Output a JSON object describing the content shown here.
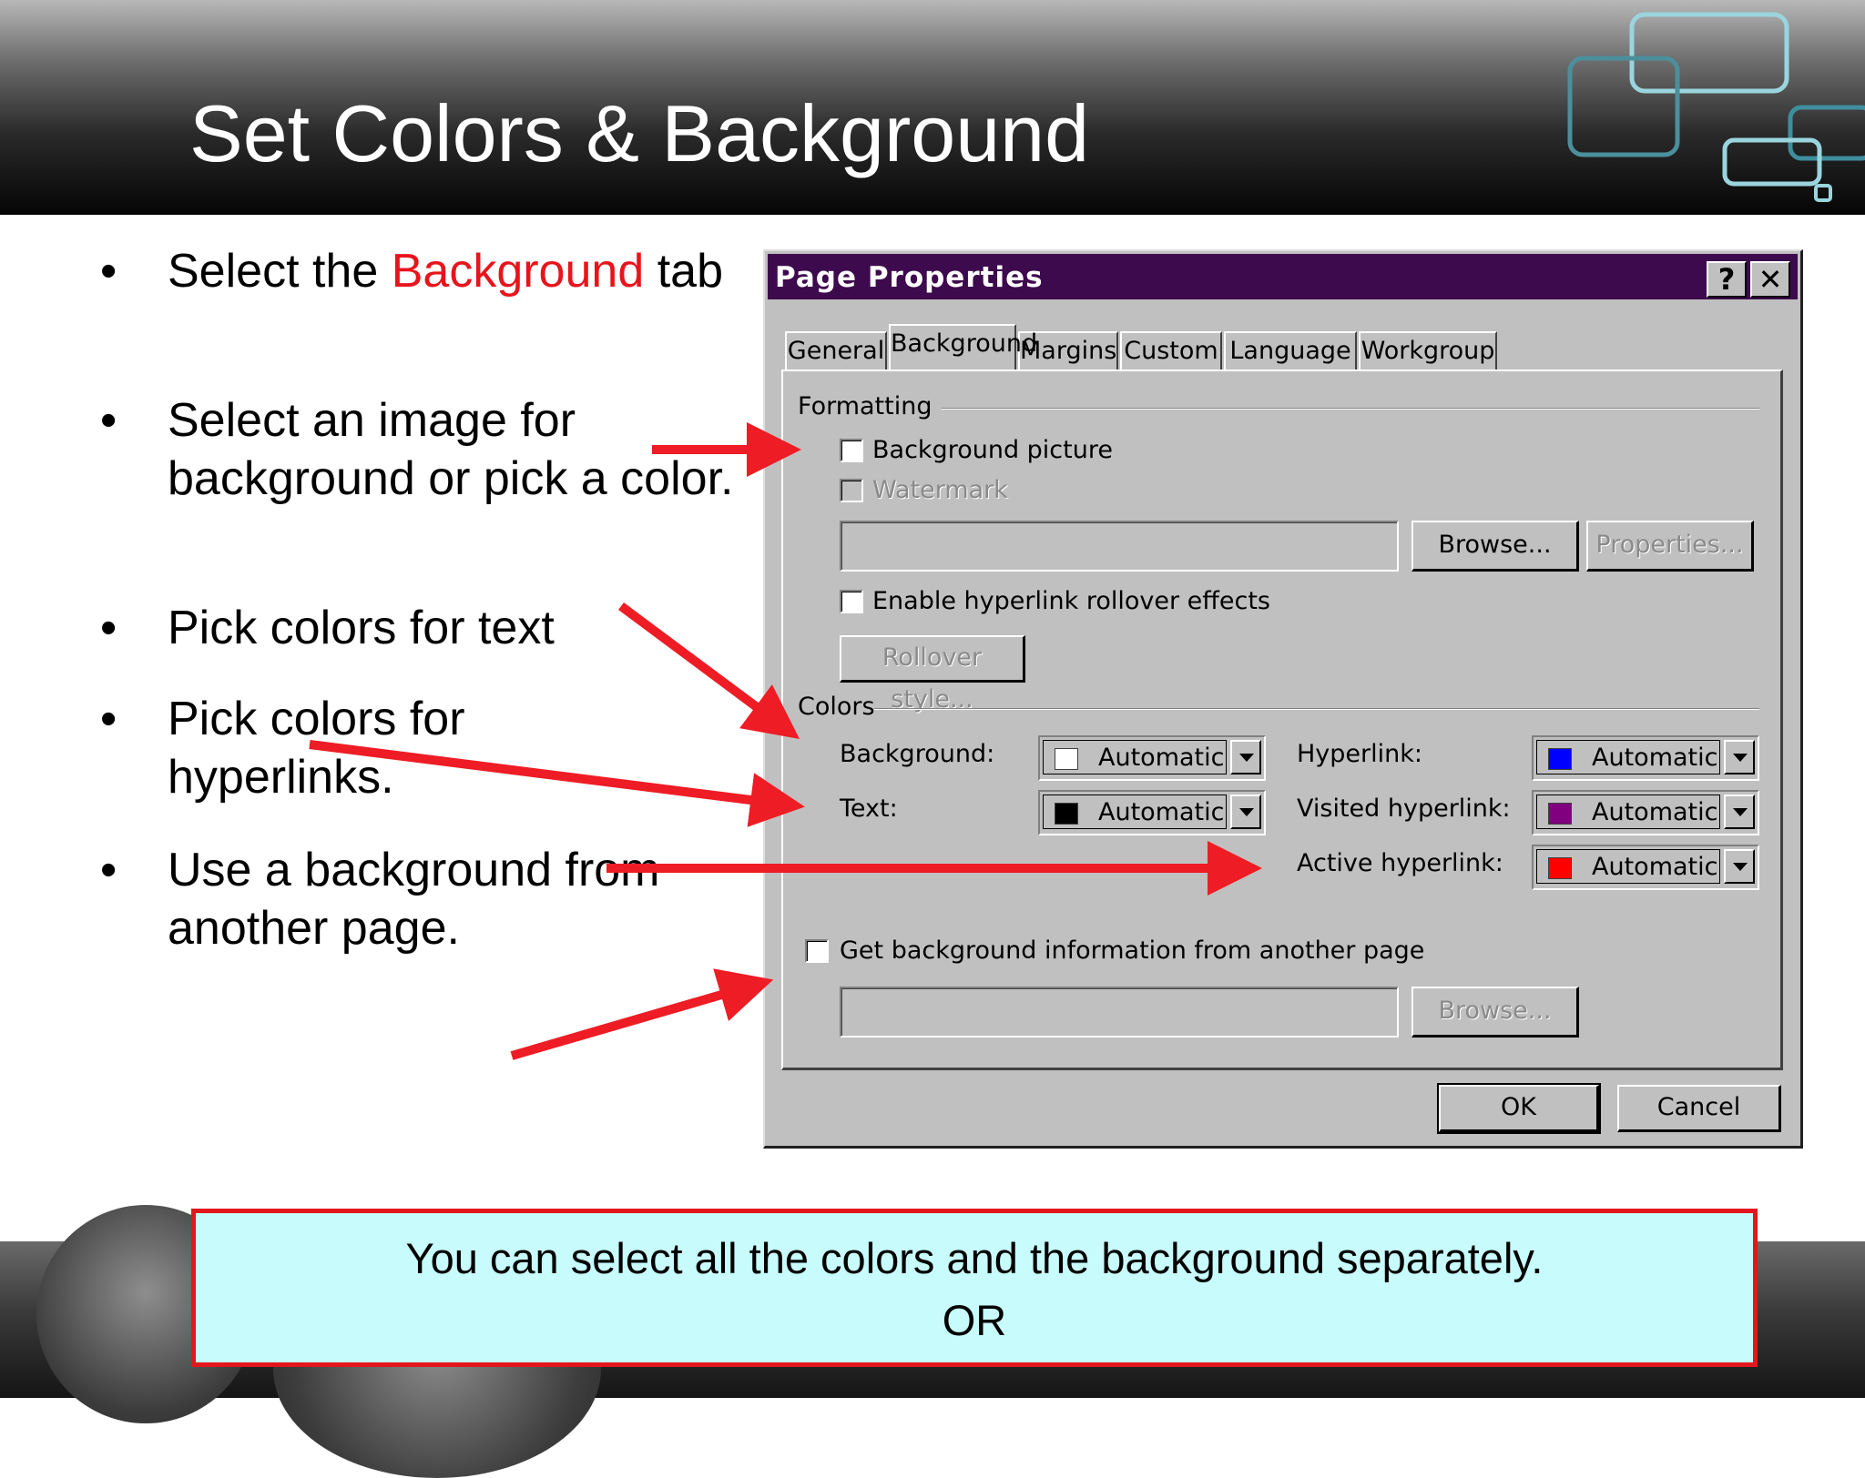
{
  "slide": {
    "title": "Set Colors & Background",
    "bullets": [
      {
        "pre": "Select the ",
        "highlight": "Background",
        "post": " tab"
      },
      {
        "pre": "Select an image for background or pick a color.",
        "highlight": "",
        "post": ""
      },
      {
        "pre": "Pick colors for text",
        "highlight": "",
        "post": ""
      },
      {
        "pre": "Pick colors for hyperlinks.",
        "highlight": "",
        "post": ""
      },
      {
        "pre": "Use a background from another page.",
        "highlight": "",
        "post": ""
      }
    ],
    "bullet_symbol": "•",
    "note_line1": "You can select all the colors and the background separately.",
    "note_line2": "OR",
    "colors": {
      "highlight": "#e8141c",
      "arrow": "#ee1c24",
      "note_bg": "#c8fbfc",
      "note_border": "#e3161b"
    }
  },
  "dialog": {
    "title": "Page Properties",
    "help_button": "?",
    "close_button": "✕",
    "tabs": [
      "General",
      "Background",
      "Margins",
      "Custom",
      "Language",
      "Workgroup"
    ],
    "active_tab": "Background",
    "formatting": {
      "group_label": "Formatting",
      "background_picture": {
        "label": "Background picture",
        "checked": false
      },
      "watermark": {
        "label": "Watermark",
        "checked": false,
        "disabled": true
      },
      "picture_path": "",
      "browse_button": "Browse...",
      "properties_button": "Properties...",
      "rollover": {
        "label": "Enable hyperlink rollover effects",
        "checked": false
      },
      "rollover_style_button": "Rollover style..."
    },
    "colors": {
      "group_label": "Colors",
      "left": [
        {
          "label": "Background:",
          "value": "Automatic",
          "swatch": "#ffffff"
        },
        {
          "label": "Text:",
          "value": "Automatic",
          "swatch": "#000000"
        }
      ],
      "right": [
        {
          "label": "Hyperlink:",
          "value": "Automatic",
          "swatch": "#0000ff"
        },
        {
          "label": "Visited hyperlink:",
          "value": "Automatic",
          "swatch": "#800080"
        },
        {
          "label": "Active hyperlink:",
          "value": "Automatic",
          "swatch": "#ff0000"
        }
      ]
    },
    "other_page": {
      "label": "Get background information from another page",
      "checked": false,
      "path": "",
      "browse_button": "Browse..."
    },
    "ok_button": "OK",
    "cancel_button": "Cancel",
    "dialog_bg": "#c0c0c0",
    "titlebar_color": "#3d0a4d"
  }
}
